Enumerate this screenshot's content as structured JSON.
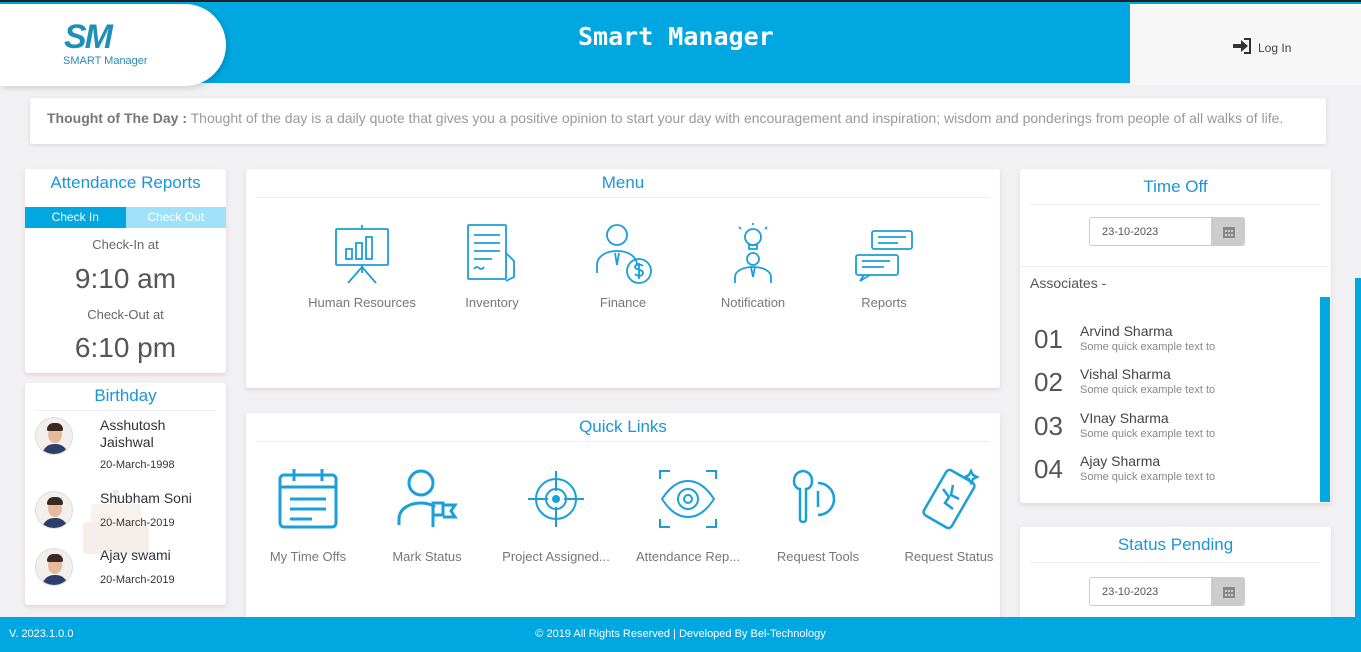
{
  "header": {
    "logo_mark": "SM",
    "logo_text": "SMART Manager",
    "app_title": "Smart Manager",
    "login_label": "Log In",
    "brand_color": "#00a7e1"
  },
  "thought": {
    "label": "Thought of The Day :",
    "text": "Thought of the day is a daily quote that gives you a positive opinion to start your day with encouragement and inspiration; wisdom and ponderings from people of all walks of life."
  },
  "attendance": {
    "title": "Attendance Reports",
    "tab_checkin": "Check In",
    "tab_checkout": "Check Out",
    "checkin_label": "Check-In at",
    "checkin_time": "9:10 am",
    "checkout_label": "Check-Out at",
    "checkout_time": "6:10 pm"
  },
  "birthday": {
    "title": "Birthday",
    "people": [
      {
        "name": "Asshutosh Jaishwal",
        "date": "20-March-1998"
      },
      {
        "name": "Shubham Soni",
        "date": "20-March-2019"
      },
      {
        "name": "Ajay swami",
        "date": "20-March-2019"
      }
    ]
  },
  "menu": {
    "title": "Menu",
    "items": [
      {
        "label": "Human Resources",
        "icon": "presentation-chart-icon"
      },
      {
        "label": "Inventory",
        "icon": "document-icon"
      },
      {
        "label": "Finance",
        "icon": "person-money-icon"
      },
      {
        "label": "Notification",
        "icon": "idea-person-icon"
      },
      {
        "label": "Reports",
        "icon": "chat-bubbles-icon"
      }
    ]
  },
  "quick_links": {
    "title": "Quick Links",
    "items": [
      {
        "label": "My Time Offs",
        "icon": "calendar-icon"
      },
      {
        "label": "Mark Status",
        "icon": "person-flag-icon"
      },
      {
        "label": "Project Assigned...",
        "icon": "target-icon"
      },
      {
        "label": "Attendance Rep...",
        "icon": "eye-scan-icon"
      },
      {
        "label": "Request Tools",
        "icon": "tools-icon"
      },
      {
        "label": "Request Status",
        "icon": "broken-phone-icon"
      }
    ]
  },
  "time_off": {
    "title": "Time Off",
    "date": "23-10-2023",
    "associates_label": "Associates -",
    "associates": [
      {
        "num": "01",
        "name": "Arvind Sharma",
        "desc": "Some quick example text to"
      },
      {
        "num": "02",
        "name": "Vishal Sharma",
        "desc": "Some quick example text to"
      },
      {
        "num": "03",
        "name": "VInay Sharma",
        "desc": "Some quick example text to"
      },
      {
        "num": "04",
        "name": "Ajay Sharma",
        "desc": "Some quick example text to"
      }
    ]
  },
  "status_pending": {
    "title": "Status Pending",
    "date": "23-10-2023"
  },
  "footer": {
    "version": "V. 2023.1.0.0",
    "copyright": "© 2019 All Rights Reserved | Developed By Bel-Technology"
  }
}
